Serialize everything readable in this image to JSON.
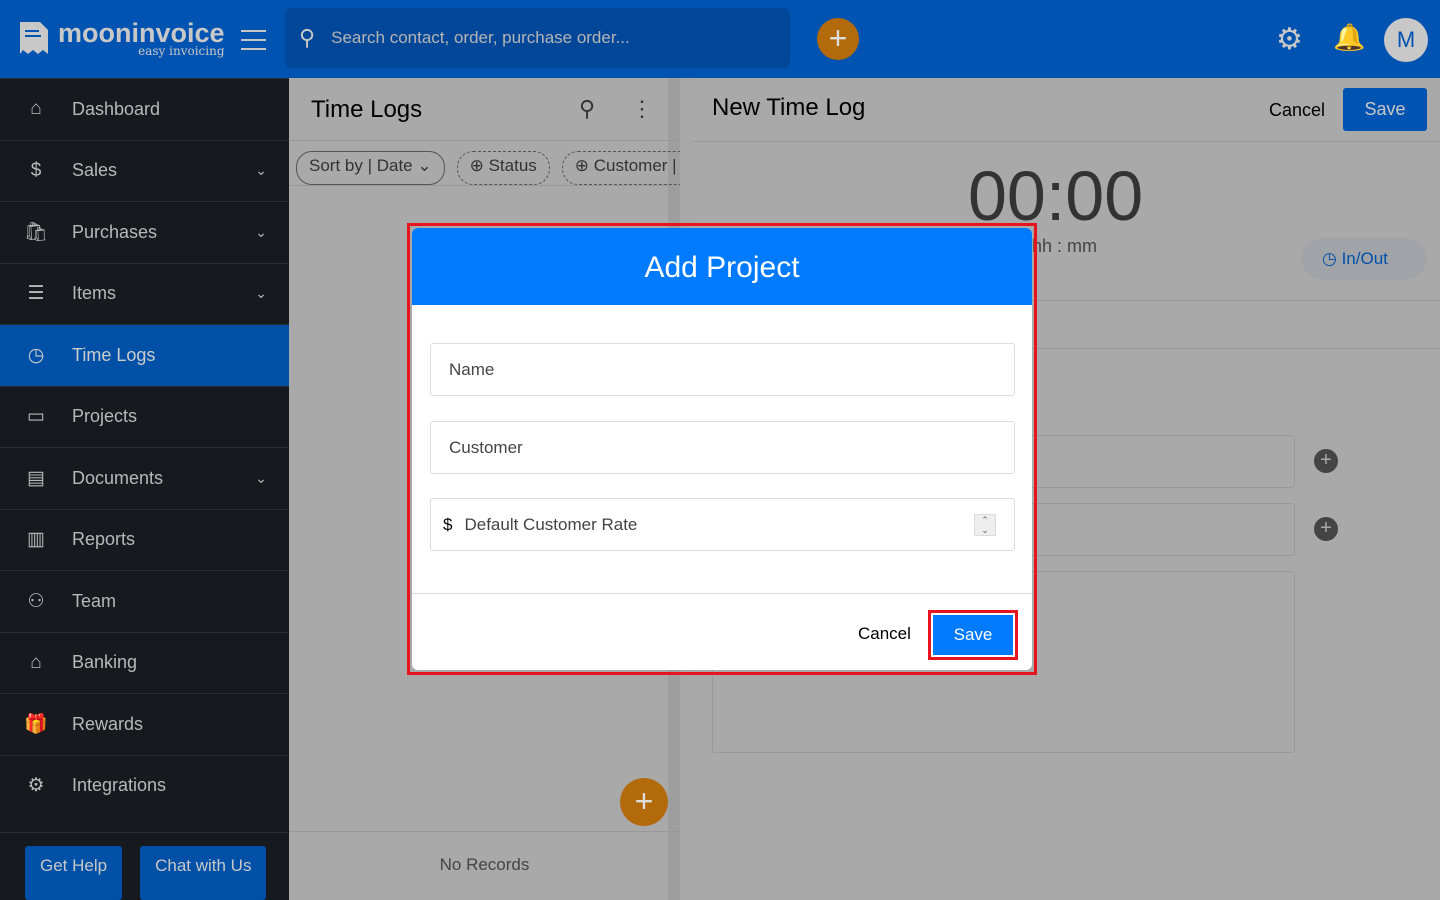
{
  "header": {
    "brand": "mooninvoice",
    "tagline": "easy invoicing",
    "search_placeholder": "Search contact, order, purchase order...",
    "avatar": "M"
  },
  "sidebar": {
    "items": [
      {
        "label": "Dashboard",
        "icon": "⌂",
        "chev": false
      },
      {
        "label": "Sales",
        "icon": "$",
        "chev": true
      },
      {
        "label": "Purchases",
        "icon": "🛍",
        "chev": true
      },
      {
        "label": "Items",
        "icon": "☰",
        "chev": true
      },
      {
        "label": "Time Logs",
        "icon": "◷",
        "chev": false,
        "active": true
      },
      {
        "label": "Projects",
        "icon": "▭",
        "chev": false
      },
      {
        "label": "Documents",
        "icon": "▤",
        "chev": true
      },
      {
        "label": "Reports",
        "icon": "▥",
        "chev": false
      },
      {
        "label": "Team",
        "icon": "⚇",
        "chev": false
      },
      {
        "label": "Banking",
        "icon": "⌂",
        "chev": false
      },
      {
        "label": "Rewards",
        "icon": "🎁",
        "chev": false
      },
      {
        "label": "Integrations",
        "icon": "⚙",
        "chev": false
      }
    ],
    "get_help": "Get Help",
    "chat": "Chat with Us"
  },
  "list": {
    "title": "Time Logs",
    "chips": [
      "Sort by | Date ⌄",
      "Status",
      "Customer | All"
    ],
    "empty": "No Records"
  },
  "form": {
    "title": "New Time Log",
    "cancel": "Cancel",
    "save": "Save",
    "timer": "00:00",
    "timer_unit": "hh : mm",
    "inout": "In/Out"
  },
  "modal": {
    "title": "Add Project",
    "name_placeholder": "Name",
    "customer_placeholder": "Customer",
    "currency": "$",
    "rate_placeholder": "Default Customer Rate",
    "cancel": "Cancel",
    "save": "Save"
  },
  "colors": {
    "accent": "#007bff",
    "highlight": "#e5141f",
    "fab": "#e08a10"
  }
}
